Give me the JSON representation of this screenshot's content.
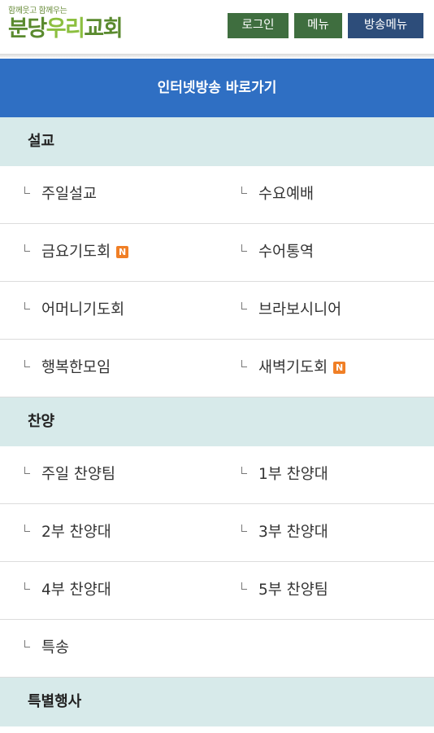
{
  "header": {
    "tagline": "함께웃고 함께우는",
    "logo_part1": "분당",
    "logo_part2": "우리",
    "logo_part3": "교회",
    "login_label": "로그인",
    "menu_label": "메뉴",
    "broadcast_menu_label": "방송메뉴"
  },
  "banner": {
    "title": "인터넷방송 바로가기"
  },
  "sections": [
    {
      "title": "설교",
      "items": [
        {
          "label": "주일설교",
          "new": false
        },
        {
          "label": "수요예배",
          "new": false
        },
        {
          "label": "금요기도회",
          "new": true
        },
        {
          "label": "수어통역",
          "new": false
        },
        {
          "label": "어머니기도회",
          "new": false
        },
        {
          "label": "브라보시니어",
          "new": false
        },
        {
          "label": "행복한모임",
          "new": false
        },
        {
          "label": "새벽기도회",
          "new": true
        }
      ]
    },
    {
      "title": "찬양",
      "items": [
        {
          "label": "주일 찬양팀",
          "new": false
        },
        {
          "label": "1부 찬양대",
          "new": false
        },
        {
          "label": "2부 찬양대",
          "new": false
        },
        {
          "label": "3부 찬양대",
          "new": false
        },
        {
          "label": "4부 찬양대",
          "new": false
        },
        {
          "label": "5부 찬양팀",
          "new": false
        },
        {
          "label": "특송",
          "new": false
        }
      ]
    },
    {
      "title": "특별행사",
      "items": []
    }
  ],
  "badge_text": "N",
  "colors": {
    "banner": "#2f6fc3",
    "section_bg": "#d7eaea",
    "login_button": "#3f6e3f",
    "broadcast_button": "#2d4d7a",
    "new_badge": "#f07f26"
  }
}
